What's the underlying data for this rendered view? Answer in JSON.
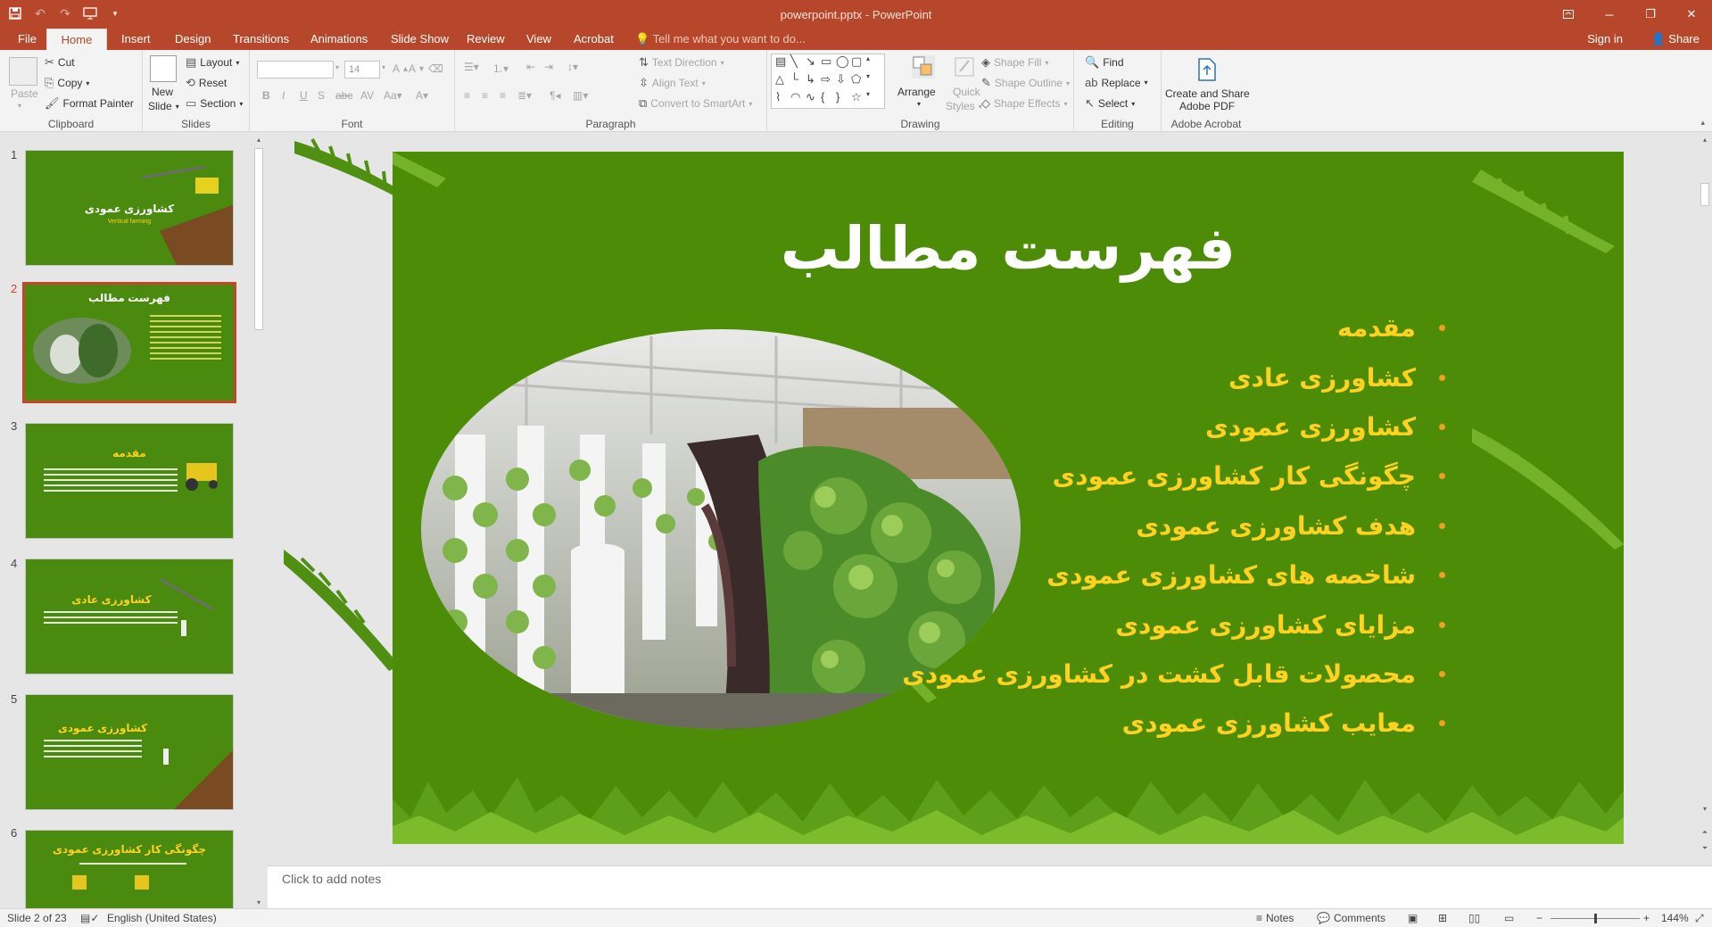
{
  "app": {
    "window_title": "powerpoint.pptx - PowerPoint",
    "accent_color": "#b7472a"
  },
  "qat": {
    "save_icon": "save-icon",
    "undo_icon": "undo-icon",
    "redo_icon": "redo-icon"
  },
  "tabs": [
    "File",
    "Home",
    "Insert",
    "Design",
    "Transitions",
    "Animations",
    "Slide Show",
    "Review",
    "View",
    "Acrobat"
  ],
  "active_tab": "Home",
  "tell_me": "Tell me what you want to do...",
  "account": {
    "sign_in": "Sign in",
    "share": "Share"
  },
  "ribbon": {
    "clipboard": {
      "label": "Clipboard",
      "paste": "Paste",
      "cut": "Cut",
      "copy": "Copy",
      "format_painter": "Format Painter"
    },
    "slides": {
      "label": "Slides",
      "new_slide_1": "New",
      "new_slide_2": "Slide",
      "layout": "Layout",
      "reset": "Reset",
      "section": "Section"
    },
    "font": {
      "label": "Font",
      "font_name": "",
      "font_size": "14"
    },
    "paragraph": {
      "label": "Paragraph",
      "text_direction": "Text Direction",
      "align_text": "Align Text",
      "convert_smartart": "Convert to SmartArt"
    },
    "drawing": {
      "label": "Drawing",
      "arrange": "Arrange",
      "quick_styles_1": "Quick",
      "quick_styles_2": "Styles",
      "shape_fill": "Shape Fill",
      "shape_outline": "Shape Outline",
      "shape_effects": "Shape Effects"
    },
    "editing": {
      "label": "Editing",
      "find": "Find",
      "replace": "Replace",
      "select": "Select"
    },
    "acrobat": {
      "label": "Adobe Acrobat",
      "create_share_1": "Create and Share",
      "create_share_2": "Adobe PDF"
    }
  },
  "thumbnails": [
    {
      "num": "1",
      "title": "کشاورزی عمودی",
      "subtitle": "Vertical farming"
    },
    {
      "num": "2",
      "title": "فهرست مطالب"
    },
    {
      "num": "3",
      "title": "مقدمه"
    },
    {
      "num": "4",
      "title": "کشاورزی عادی"
    },
    {
      "num": "5",
      "title": "کشاورزی عمودی"
    },
    {
      "num": "6",
      "title": "چگونگی کار کشاورزی عمودی"
    }
  ],
  "slide": {
    "title": "فهرست مطالب",
    "items": [
      "مقدمه",
      "کشاورزی عادی",
      "کشاورزی عمودی",
      "چگونگی کار کشاورزی عمودی",
      "هدف کشاورزی عمودی",
      "شاخصه های کشاورزی عمودی",
      "مزایای کشاورزی عمودی",
      "محصولات قابل کشت در کشاورزی عمودی",
      "معایب کشاورزی عمودی"
    ],
    "bg_color": "#4d8c07",
    "item_color": "#ffd21f",
    "bullet_color": "#f0a020"
  },
  "notes_placeholder": "Click to add notes",
  "status": {
    "slide_info": "Slide 2 of 23",
    "language": "English (United States)",
    "notes": "Notes",
    "comments": "Comments",
    "zoom": "144%"
  }
}
